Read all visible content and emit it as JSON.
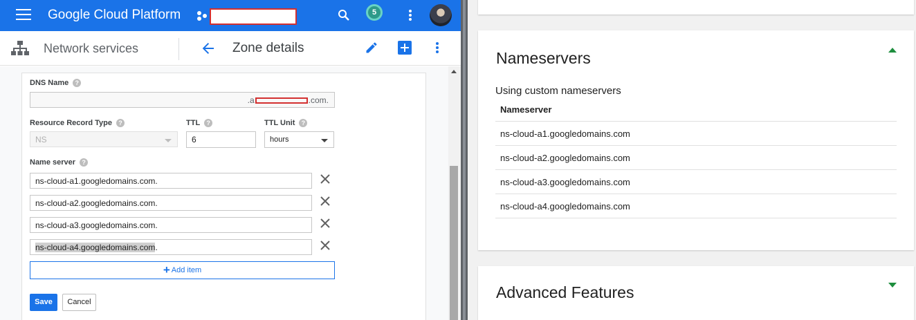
{
  "topbar": {
    "brand": "Google Cloud Platform",
    "notifications_count": "5"
  },
  "subbar": {
    "section": "Network services",
    "title": "Zone details"
  },
  "form": {
    "dns_name": {
      "label": "DNS Name",
      "value_visible": ".a",
      "value_suffix": ".com."
    },
    "record_type": {
      "label": "Resource Record Type",
      "value": "NS"
    },
    "ttl": {
      "label": "TTL",
      "value": "6"
    },
    "ttl_unit": {
      "label": "TTL Unit",
      "value": "hours"
    },
    "name_server": {
      "label": "Name server",
      "items": [
        {
          "value": "ns-cloud-a1.googledomains.com."
        },
        {
          "value": "ns-cloud-a2.googledomains.com."
        },
        {
          "value": "ns-cloud-a3.googledomains.com."
        },
        {
          "value_selected": "ns-cloud-a4.googledomains.com",
          "value_rest": "."
        }
      ]
    },
    "add_item_label": "Add item",
    "save_label": "Save",
    "cancel_label": "Cancel"
  },
  "nameservers_card": {
    "title": "Nameservers",
    "subtitle": "Using custom nameservers",
    "column_header": "Nameserver",
    "rows": [
      "ns-cloud-a1.googledomains.com",
      "ns-cloud-a2.googledomains.com",
      "ns-cloud-a3.googledomains.com",
      "ns-cloud-a4.googledomains.com"
    ]
  },
  "advanced_card": {
    "title": "Advanced Features"
  },
  "icons": {
    "menu": "hamburger-menu-icon",
    "project": "project-dots-icon",
    "search": "search-icon",
    "more": "more-vert-icon",
    "back": "arrow-back-icon",
    "edit": "edit-pencil-icon",
    "add": "add-box-icon",
    "network": "network-services-icon",
    "remove": "close-icon",
    "help": "help-icon",
    "expand": "chevron-up-icon",
    "collapse": "chevron-down-icon"
  },
  "colors": {
    "brand_blue": "#1a73e8",
    "chevron_green": "#1e8e3e",
    "redaction_red": "#d32f2f"
  }
}
